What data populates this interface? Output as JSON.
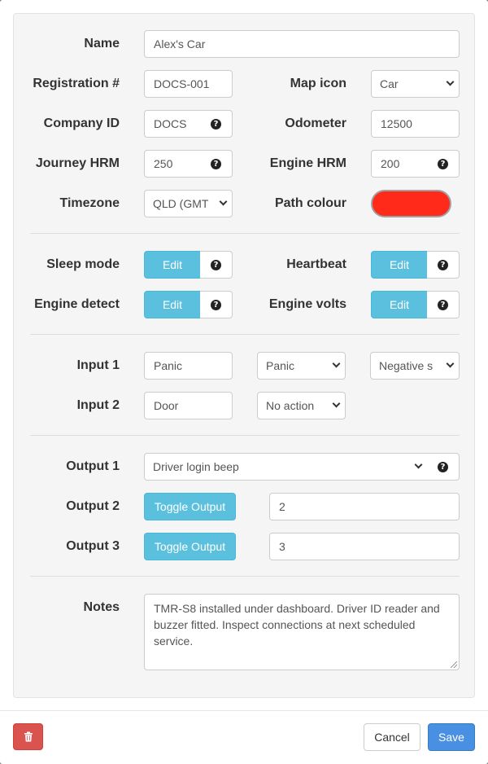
{
  "form": {
    "name": {
      "label": "Name",
      "value": "Alex's Car"
    },
    "registration": {
      "label": "Registration #",
      "value": "DOCS-001"
    },
    "map_icon": {
      "label": "Map icon",
      "value": "Car"
    },
    "company_id": {
      "label": "Company ID",
      "value": "DOCS"
    },
    "odometer": {
      "label": "Odometer",
      "value": "12500"
    },
    "journey_hrm": {
      "label": "Journey HRM",
      "value": "250"
    },
    "engine_hrm": {
      "label": "Engine HRM",
      "value": "200"
    },
    "timezone": {
      "label": "Timezone",
      "value": "QLD (GMT"
    },
    "path_colour": {
      "label": "Path colour",
      "color": "#ff2a1a"
    },
    "sleep_mode": {
      "label": "Sleep mode",
      "button": "Edit"
    },
    "heartbeat": {
      "label": "Heartbeat",
      "button": "Edit"
    },
    "engine_detect": {
      "label": "Engine detect",
      "button": "Edit"
    },
    "engine_volts": {
      "label": "Engine volts",
      "button": "Edit"
    },
    "input1": {
      "label": "Input 1",
      "name": "Panic",
      "action": "Panic",
      "polarity": "Negative s"
    },
    "input2": {
      "label": "Input 2",
      "name": "Door",
      "action": "No action"
    },
    "output1": {
      "label": "Output 1",
      "value": "Driver login beep"
    },
    "output2": {
      "label": "Output 2",
      "button": "Toggle Output",
      "value": "2"
    },
    "output3": {
      "label": "Output 3",
      "button": "Toggle Output",
      "value": "3"
    },
    "notes": {
      "label": "Notes",
      "value": "TMR-S8 installed under dashboard. Driver ID reader and buzzer fitted. Inspect connections at next scheduled service."
    }
  },
  "footer": {
    "delete_icon": "trash-icon",
    "cancel_label": "Cancel",
    "save_label": "Save"
  },
  "colors": {
    "info": "#5bc0de",
    "danger": "#d9534f",
    "primary": "#4a90e2"
  }
}
